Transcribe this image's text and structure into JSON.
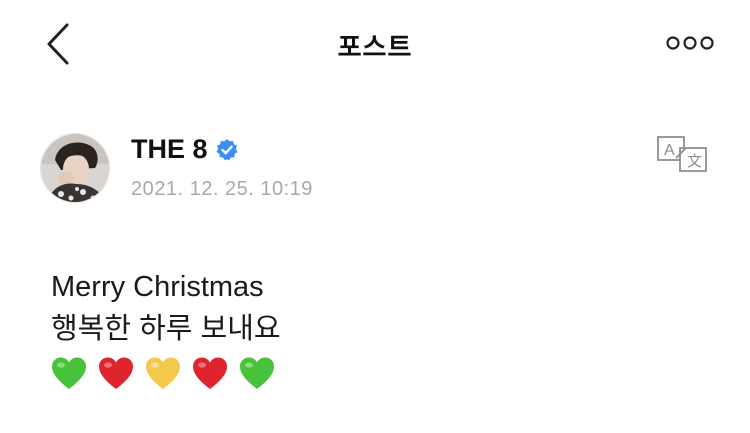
{
  "header": {
    "title": "포스트",
    "back_icon": "chevron-left-icon",
    "more_icon": "more-horizontal-icon"
  },
  "author": {
    "name": "THE 8",
    "verified": true,
    "verified_color": "#3a8ef6",
    "date": "2021. 12. 25. 10:19"
  },
  "translate_icon": "translate-icon",
  "post": {
    "line1": "Merry Christmas",
    "line2": "행복한 하루 보내요",
    "hearts": [
      "green",
      "red",
      "yellow",
      "red",
      "green"
    ]
  },
  "colors": {
    "heart_green": "#47c23a",
    "heart_red": "#e0242e",
    "heart_yellow": "#f4c94a",
    "date_gray": "#a9a9a9",
    "icon_gray": "#8e8e8e"
  }
}
